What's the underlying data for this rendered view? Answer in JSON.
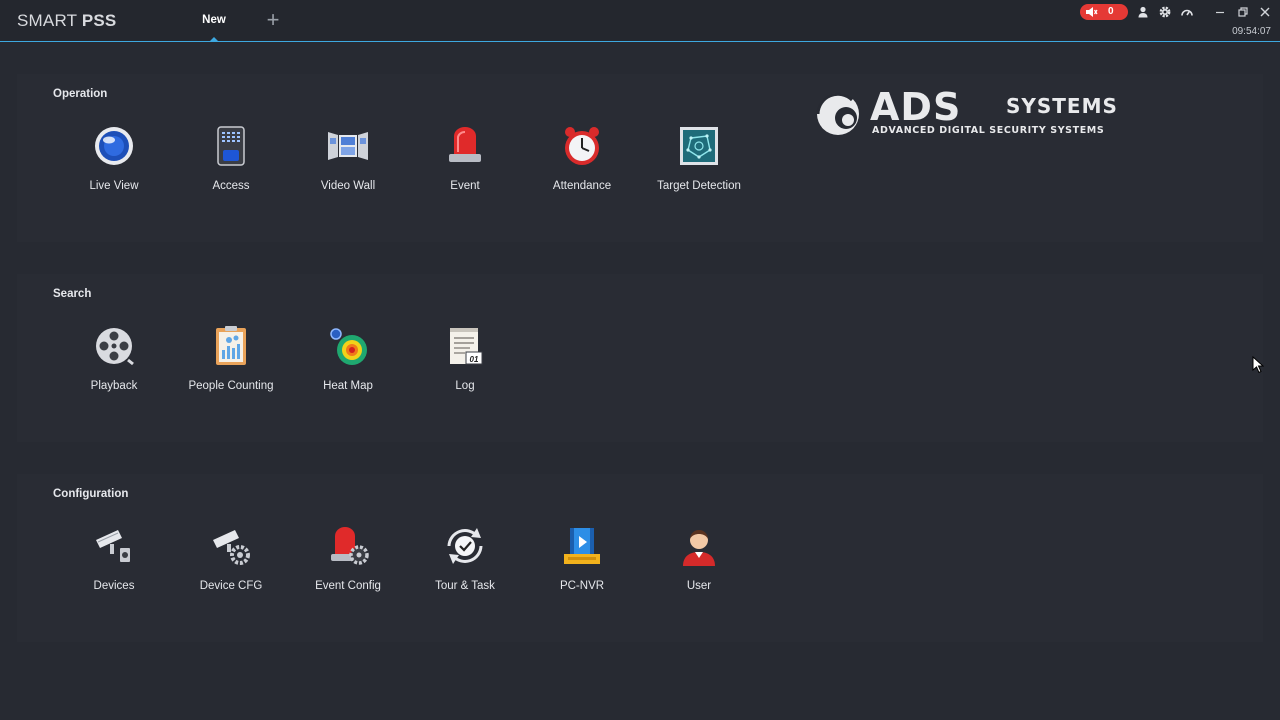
{
  "window": {
    "title_light": "SMART ",
    "title_bold": "PSS",
    "tabs": [
      {
        "label": "New",
        "active": true
      }
    ],
    "add_tab_symbol": "+",
    "alarm_count": "0",
    "clock": "09:54:07",
    "accent_color": "#3da8e0",
    "alarm_color": "#e53935",
    "toolbar_icons": [
      "speaker-icon",
      "user-icon",
      "gear-icon",
      "speed-icon",
      "minimize-icon",
      "restore-icon",
      "close-icon"
    ]
  },
  "logo": {
    "main": "ADS",
    "systems": "SYSTEMS",
    "subtitle": "ADVANCED DIGITAL SECURITY SYSTEMS"
  },
  "sections": [
    {
      "title": "Operation",
      "items": [
        {
          "label": "Live View",
          "icon": "live-view-icon"
        },
        {
          "label": "Access",
          "icon": "access-icon"
        },
        {
          "label": "Video Wall",
          "icon": "video-wall-icon"
        },
        {
          "label": "Event",
          "icon": "event-icon"
        },
        {
          "label": "Attendance",
          "icon": "attendance-icon"
        },
        {
          "label": "Target Detection",
          "icon": "target-detection-icon"
        }
      ]
    },
    {
      "title": "Search",
      "items": [
        {
          "label": "Playback",
          "icon": "playback-icon"
        },
        {
          "label": "People Counting",
          "icon": "people-counting-icon"
        },
        {
          "label": "Heat Map",
          "icon": "heat-map-icon"
        },
        {
          "label": "Log",
          "icon": "log-icon"
        }
      ]
    },
    {
      "title": "Configuration",
      "items": [
        {
          "label": "Devices",
          "icon": "devices-icon"
        },
        {
          "label": "Device CFG",
          "icon": "device-cfg-icon"
        },
        {
          "label": "Event Config",
          "icon": "event-config-icon"
        },
        {
          "label": "Tour & Task",
          "icon": "tour-task-icon"
        },
        {
          "label": "PC-NVR",
          "icon": "pc-nvr-icon"
        },
        {
          "label": "User",
          "icon": "user-icon"
        }
      ]
    }
  ]
}
